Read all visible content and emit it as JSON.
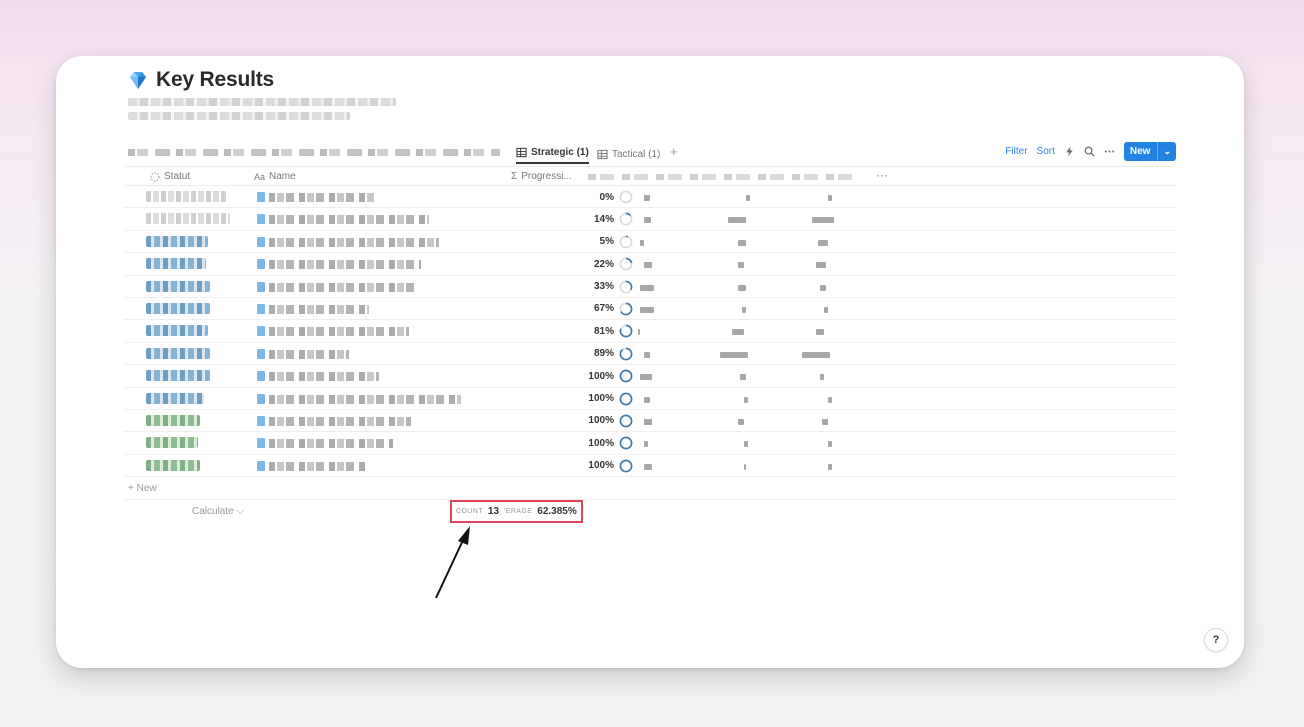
{
  "page": {
    "title": "Key Results",
    "icon": "gem-icon"
  },
  "views": {
    "tabs": [
      {
        "label": "Strategic (1)",
        "active": true,
        "icon": "table-icon"
      },
      {
        "label": "Tactical (1)",
        "active": false,
        "icon": "table-icon"
      }
    ],
    "add": "+"
  },
  "toolbar": {
    "filter": "Filter",
    "sort": "Sort",
    "new": "New"
  },
  "table": {
    "columns": {
      "status": "Statut",
      "name": "Name",
      "progress": "Progressi..."
    },
    "status_icon": "loader-icon",
    "name_prefix": "Aa",
    "progress_prefix": "Σ",
    "rows": [
      {
        "progress": "0%",
        "value": 0,
        "status_color": "grey"
      },
      {
        "progress": "14%",
        "value": 14,
        "status_color": "grey"
      },
      {
        "progress": "5%",
        "value": 5,
        "status_color": "blue"
      },
      {
        "progress": "22%",
        "value": 22,
        "status_color": "blue"
      },
      {
        "progress": "33%",
        "value": 33,
        "status_color": "blue"
      },
      {
        "progress": "67%",
        "value": 67,
        "status_color": "blue"
      },
      {
        "progress": "81%",
        "value": 81,
        "status_color": "blue"
      },
      {
        "progress": "89%",
        "value": 89,
        "status_color": "blue"
      },
      {
        "progress": "100%",
        "value": 100,
        "status_color": "blue"
      },
      {
        "progress": "100%",
        "value": 100,
        "status_color": "blue"
      },
      {
        "progress": "100%",
        "value": 100,
        "status_color": "green"
      },
      {
        "progress": "100%",
        "value": 100,
        "status_color": "green"
      },
      {
        "progress": "100%",
        "value": 100,
        "status_color": "green"
      }
    ],
    "new_row": "+ New",
    "calculate": "Calculate ⌵",
    "aggregate": {
      "count_label": "COUNT",
      "count": "13",
      "avg_label": "'ERAGE",
      "avg": "62.385%"
    }
  },
  "help": "?",
  "colors": {
    "accent": "#2383e2",
    "ring": "#3f78a8",
    "highlight": "#e0475e"
  }
}
